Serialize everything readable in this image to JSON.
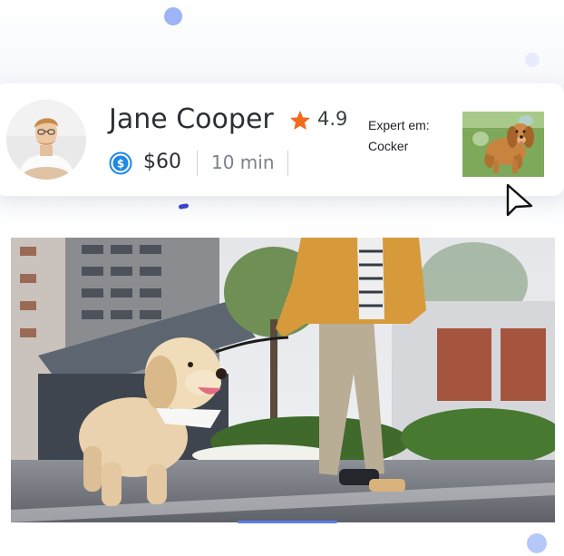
{
  "walker": {
    "name": "Jane Cooper",
    "rating": "4.9",
    "price": "$60",
    "duration": "10 min",
    "expert_label": "Expert em:",
    "expert_breed": "Cocker"
  },
  "icons": {
    "rating": "star-icon",
    "price": "dollar-coin-icon",
    "pointer": "cursor-arrow-icon"
  },
  "colors": {
    "star": "#f26a1b",
    "coin": "#1e88e5",
    "accent_dot": "#9db4f6",
    "text_dark": "#2d2f36",
    "text_muted": "#7c808a"
  }
}
